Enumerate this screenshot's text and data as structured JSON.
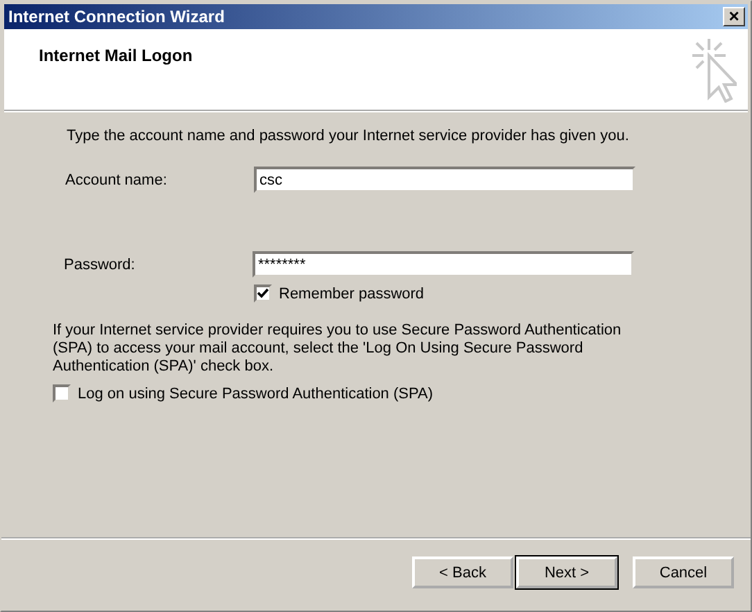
{
  "window": {
    "title": "Internet Connection Wizard",
    "close": "×"
  },
  "header": {
    "title": "Internet Mail Logon"
  },
  "intro": "Type the account name and password your Internet service provider has given you.",
  "fields": [
    {
      "label": "Account name:",
      "value": "csc"
    },
    {
      "label": "Password:",
      "value": "********"
    }
  ],
  "remember_password": {
    "label": "Remember password",
    "checked": true
  },
  "spa_note": "If your Internet service provider requires you to use Secure Password Authentication (SPA) to access your mail account, select the 'Log On Using Secure Password Authentication (SPA)' check box.",
  "spa": {
    "label": "Log on using Secure Password Authentication (SPA)",
    "checked": false
  },
  "buttons": [
    {
      "label": "< Back",
      "default": false
    },
    {
      "label": "Next >",
      "default": true
    },
    {
      "label": "Cancel",
      "default": false
    }
  ]
}
